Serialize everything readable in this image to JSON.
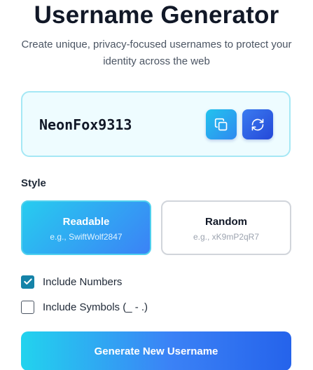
{
  "header": {
    "title": "Username Generator",
    "subtitle": "Create unique, privacy-focused usernames to protect your identity across the web"
  },
  "result": {
    "username": "NeonFox9313",
    "copy_icon": "copy-icon",
    "refresh_icon": "refresh-icon"
  },
  "style": {
    "label": "Style",
    "options": [
      {
        "name": "Readable",
        "example": "e.g., SwiftWolf2847",
        "selected": true
      },
      {
        "name": "Random",
        "example": "e.g., xK9mP2qR7",
        "selected": false
      }
    ]
  },
  "options": {
    "include_numbers": {
      "label": "Include Numbers",
      "checked": true
    },
    "include_symbols": {
      "label": "Include Symbols (_ - .)",
      "checked": false
    }
  },
  "actions": {
    "generate_label": "Generate New Username"
  },
  "colors": {
    "accent_cyan": "#22d3ee",
    "accent_blue": "#2563eb",
    "checkbox_checked": "#1583a8",
    "card_border": "#a5e8f5",
    "card_bg": "#eefcff"
  }
}
